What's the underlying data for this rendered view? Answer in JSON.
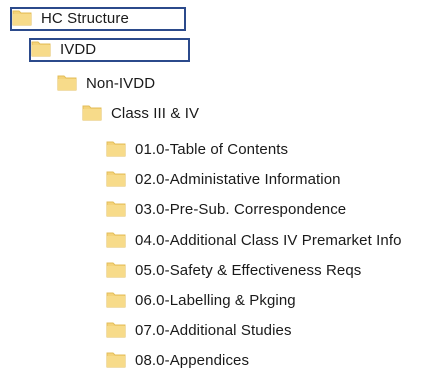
{
  "tree": {
    "folder_icon": "folder-icon",
    "folder_color": "#F4D37A",
    "folder_edge_color": "#E3BE58",
    "highlight_border_color": "#2B4A8B",
    "nodes": [
      {
        "id": "hc-structure",
        "label": "HC Structure",
        "depth": 0,
        "highlighted": true
      },
      {
        "id": "ivdd",
        "label": "IVDD",
        "depth": 1,
        "highlighted": true
      },
      {
        "id": "non-ivdd",
        "label": "Non-IVDD",
        "depth": 1,
        "highlighted": false
      },
      {
        "id": "class-iii-iv",
        "label": "Class III & IV",
        "depth": 2,
        "highlighted": false
      },
      {
        "id": "toc",
        "label": "01.0-Table of Contents",
        "depth": 3,
        "highlighted": false
      },
      {
        "id": "admin-info",
        "label": "02.0-Administative Information",
        "depth": 3,
        "highlighted": false
      },
      {
        "id": "presub",
        "label": "03.0-Pre-Sub. Correspondence",
        "depth": 3,
        "highlighted": false
      },
      {
        "id": "class-iv-premarket",
        "label": "04.0-Additional Class IV Premarket Info",
        "depth": 3,
        "highlighted": false
      },
      {
        "id": "safety",
        "label": "05.0-Safety & Effectiveness Reqs",
        "depth": 3,
        "highlighted": false
      },
      {
        "id": "labelling",
        "label": "06.0-Labelling & Pkging",
        "depth": 3,
        "highlighted": false
      },
      {
        "id": "studies",
        "label": "07.0-Additional Studies",
        "depth": 3,
        "highlighted": false
      },
      {
        "id": "appendices",
        "label": "08.0-Appendices",
        "depth": 3,
        "highlighted": false
      }
    ]
  }
}
